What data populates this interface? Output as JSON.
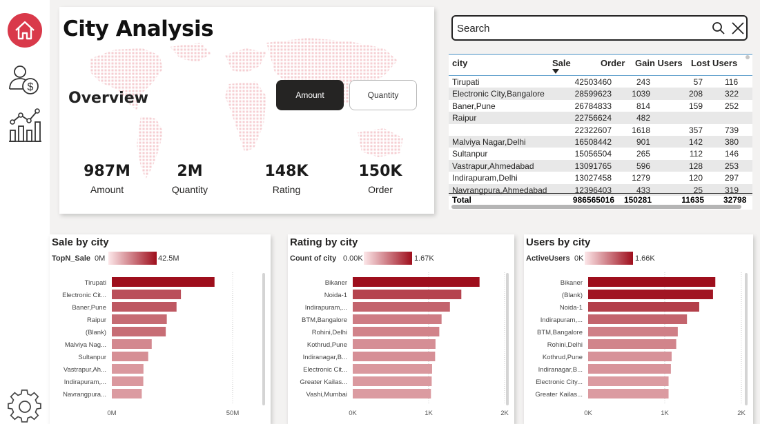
{
  "sidebar": {
    "items": [
      {
        "name": "home-icon"
      },
      {
        "name": "user-dollar-icon"
      },
      {
        "name": "chart-analytics-icon"
      },
      {
        "name": "settings-gear-icon"
      }
    ]
  },
  "header": {
    "title": "City Analysis"
  },
  "overview": {
    "title": "Overview",
    "toggle_amount": "Amount",
    "toggle_quantity": "Quantity",
    "kpis": [
      {
        "value": "987M",
        "label": "Amount"
      },
      {
        "value": "2M",
        "label": "Quantity"
      },
      {
        "value": "148K",
        "label": "Rating"
      },
      {
        "value": "150K",
        "label": "Order"
      }
    ]
  },
  "search": {
    "placeholder": "Search",
    "value": ""
  },
  "table": {
    "columns": [
      "city",
      "Sale",
      "Order",
      "Gain Users",
      "Lost Users"
    ],
    "rows": [
      [
        "Tirupati",
        "42503460",
        "243",
        "57",
        "116"
      ],
      [
        "Electronic City,Bangalore",
        "28599623",
        "1039",
        "208",
        "322"
      ],
      [
        "Baner,Pune",
        "26784833",
        "814",
        "159",
        "252"
      ],
      [
        "Raipur",
        "22756624",
        "482",
        "",
        ""
      ],
      [
        "",
        "22322607",
        "1618",
        "357",
        "739"
      ],
      [
        "Malviya Nagar,Delhi",
        "16508442",
        "901",
        "142",
        "380"
      ],
      [
        "Sultanpur",
        "15056504",
        "265",
        "112",
        "146"
      ],
      [
        "Vastrapur,Ahmedabad",
        "13091765",
        "596",
        "128",
        "253"
      ],
      [
        "Indirapuram,Delhi",
        "13027458",
        "1279",
        "120",
        "297"
      ],
      [
        "Navrangpura,Ahmedabad",
        "12396403",
        "433",
        "25",
        "319"
      ]
    ],
    "total": [
      "Total",
      "986565016",
      "150281",
      "11635",
      "32798"
    ]
  },
  "colors": {
    "accent": "#d9394a",
    "bar_dark": "#9e0e1c",
    "bar_light": "#fce7e9"
  },
  "chart_data": [
    {
      "type": "bar",
      "orientation": "horizontal",
      "title": "Sale by city",
      "legend_label": "TopN_Sale",
      "legend_min": "0M",
      "legend_max": "42.5M",
      "categories": [
        "Tirupati",
        "Electronic Cit...",
        "Baner,Pune",
        "Raipur",
        "(Blank)",
        "Malviya Nag...",
        "Sultanpur",
        "Vastrapur,Ah...",
        "Indirapuram,...",
        "Navrangpura..."
      ],
      "values": [
        42503460,
        28599623,
        26784833,
        22756624,
        22322607,
        16508442,
        15056504,
        13091765,
        13027458,
        12396403
      ],
      "xlim": [
        0,
        50000000
      ],
      "ticks": [
        "0M",
        "50M"
      ],
      "tick_values": [
        0,
        50000000
      ]
    },
    {
      "type": "bar",
      "orientation": "horizontal",
      "title": "Rating by city",
      "legend_label": "Count of city",
      "legend_min": "0.00K",
      "legend_max": "1.67K",
      "categories": [
        "Bikaner",
        "Noida-1",
        "Indirapuram,...",
        "BTM,Bangalore",
        "Rohini,Delhi",
        "Kothrud,Pune",
        "Indiranagar,B...",
        "Electronic Cit...",
        "Greater Kailas...",
        "Vashi,Mumbai"
      ],
      "values": [
        1670,
        1430,
        1280,
        1170,
        1140,
        1090,
        1085,
        1045,
        1040,
        1030
      ],
      "xlim": [
        0,
        2000
      ],
      "ticks": [
        "0K",
        "1K",
        "2K"
      ],
      "tick_values": [
        0,
        1000,
        2000
      ]
    },
    {
      "type": "bar",
      "orientation": "horizontal",
      "title": "Users by city",
      "legend_label": "ActiveUsers",
      "legend_min": "0K",
      "legend_max": "1.66K",
      "categories": [
        "Bikaner",
        "(Blank)",
        "Noida-1",
        "Indirapuram,...",
        "BTM,Bangalore",
        "Rohini,Delhi",
        "Kothrud,Pune",
        "Indiranagar,B...",
        "Electronic City...",
        "Greater Kailas..."
      ],
      "values": [
        1660,
        1630,
        1450,
        1290,
        1170,
        1150,
        1090,
        1080,
        1050,
        1050
      ],
      "xlim": [
        0,
        2000
      ],
      "ticks": [
        "0K",
        "1K",
        "2K"
      ],
      "tick_values": [
        0,
        1000,
        2000
      ]
    }
  ]
}
